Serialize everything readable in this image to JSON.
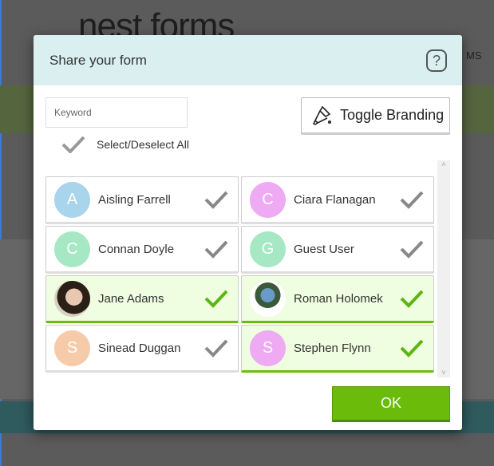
{
  "app": {
    "logo_text": "nest forms",
    "nav_partial": "MS"
  },
  "dialog": {
    "title": "Share your form",
    "help_label": "?",
    "keyword_placeholder": "Keyword",
    "toggle_branding_label": "Toggle Branding",
    "select_all_label": "Select/Deselect All",
    "ok_label": "OK",
    "users": [
      {
        "initial": "A",
        "name": "Aisling Farrell",
        "color": "#a8d4ec",
        "selected": false
      },
      {
        "initial": "C",
        "name": "Ciara Flanagan",
        "color": "#eeaaf2",
        "selected": false
      },
      {
        "initial": "C",
        "name": "Connan Doyle",
        "color": "#a6e8c4",
        "selected": false
      },
      {
        "initial": "G",
        "name": "Guest User",
        "color": "#a6e8c4",
        "selected": false
      },
      {
        "initial": "",
        "name": "Jane Adams",
        "color": "#5a4a3a",
        "selected": true,
        "photo": true
      },
      {
        "initial": "",
        "name": "Roman Holomek",
        "color": "#ffffff",
        "selected": true,
        "photo": true
      },
      {
        "initial": "S",
        "name": "Sinead Duggan",
        "color": "#f6cbaa",
        "selected": false
      },
      {
        "initial": "S",
        "name": "Stephen Flynn",
        "color": "#eeaaf2",
        "selected": true
      }
    ]
  },
  "colors": {
    "accent": "#6bbb0a",
    "header_bg": "#daf0f0",
    "check_gray": "#888888"
  }
}
